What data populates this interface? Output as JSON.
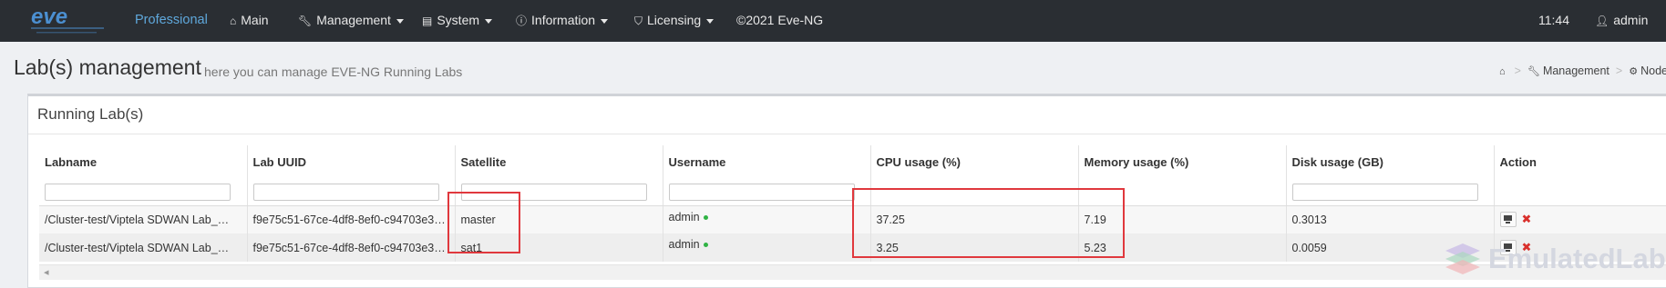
{
  "navbar": {
    "brand": "Professional",
    "items": [
      {
        "label": "Main",
        "icon": "home-icon",
        "glyph": "⌂"
      },
      {
        "label": "Management",
        "icon": "wrench-icon",
        "glyph": "🔧︎"
      },
      {
        "label": "System",
        "icon": "book-icon",
        "glyph": "▤"
      },
      {
        "label": "Information",
        "icon": "info-icon",
        "glyph": "ⓘ"
      },
      {
        "label": "Licensing",
        "icon": "shield-icon",
        "glyph": "⛉"
      }
    ],
    "copyright": "©2021 Eve-NG",
    "clock": "11:44",
    "user": "admin"
  },
  "page": {
    "title": "Lab(s) management",
    "subtitle": "here you can manage EVE-NG Running Labs",
    "breadcrumb": [
      "Management",
      "Nodes"
    ]
  },
  "panel": {
    "title": "Running Lab(s)"
  },
  "table": {
    "columns": [
      "Labname",
      "Lab UUID",
      "Satellite",
      "Username",
      "CPU usage (%)",
      "Memory usage (%)",
      "Disk usage (GB)",
      "Action"
    ],
    "rows": [
      {
        "labname": "/Cluster-test/Viptela SDWAN Lab_…",
        "uuid": "f9e75c51-67ce-4df8-8ef0-c94703e3…",
        "satellite": "master",
        "username": "admin",
        "cpu": "37.25",
        "memory": "7.19",
        "disk": "0.3013"
      },
      {
        "labname": "/Cluster-test/Viptela SDWAN Lab_…",
        "uuid": "f9e75c51-67ce-4df8-8ef0-c94703e3…",
        "satellite": "sat1",
        "username": "admin",
        "cpu": "3.25",
        "memory": "5.23",
        "disk": "0.0059"
      }
    ]
  },
  "colors": {
    "navbar": "#2a2e33",
    "brand": "#5fa8dc",
    "highlight": "#e0383d",
    "online": "#2fb344",
    "stop": "#d9302c"
  },
  "watermark": {
    "text": "EmulatedLab"
  }
}
